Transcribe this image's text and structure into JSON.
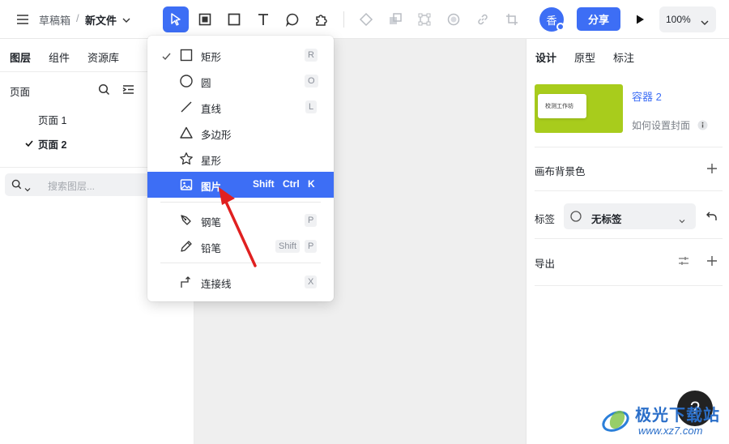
{
  "header": {
    "breadcrumb_root": "草稿箱",
    "breadcrumb_sep": "/",
    "file_name": "新文件",
    "avatar_text": "香",
    "share_label": "分享",
    "zoom_label": "100%"
  },
  "left_panel": {
    "tabs": [
      "图层",
      "组件",
      "资源库"
    ],
    "pages_title": "页面",
    "pages": [
      {
        "label": "页面 1",
        "selected": false
      },
      {
        "label": "页面 2",
        "selected": true
      }
    ],
    "search_placeholder": "搜索图层..."
  },
  "shape_menu": {
    "items": [
      {
        "label": "矩形",
        "shortcut": "R",
        "checked": true,
        "icon": "rectangle-icon"
      },
      {
        "label": "圆",
        "shortcut": "O",
        "checked": false,
        "icon": "circle-icon"
      },
      {
        "label": "直线",
        "shortcut": "L",
        "checked": false,
        "icon": "line-icon"
      },
      {
        "label": "多边形",
        "shortcut": "",
        "checked": false,
        "icon": "triangle-icon"
      },
      {
        "label": "星形",
        "shortcut": "",
        "checked": false,
        "icon": "star-icon"
      },
      {
        "label": "图片",
        "shortcut_keys": [
          "Shift",
          "Ctrl",
          "K"
        ],
        "highlighted": true,
        "icon": "image-icon"
      },
      {
        "label": "钢笔",
        "shortcut": "P",
        "checked": false,
        "icon": "pen-icon"
      },
      {
        "label": "铅笔",
        "shortcut_keys": [
          "Shift",
          "P"
        ],
        "checked": false,
        "icon": "pencil-icon"
      },
      {
        "label": "连接线",
        "shortcut": "X",
        "checked": false,
        "icon": "connector-icon"
      }
    ]
  },
  "right_panel": {
    "tabs": [
      "设计",
      "原型",
      "标注"
    ],
    "active_tab": "设计",
    "container_name": "容器 2",
    "thumb_text": "校测工作坊",
    "cover_help": "如何设置封面",
    "canvas_bg_label": "画布背景色",
    "tag_label": "标签",
    "tag_value": "无标签",
    "export_label": "导出"
  },
  "colors": {
    "accent": "#3d6ef5",
    "thumb_green": "#a8cc1c",
    "arrow_red": "#e02020",
    "canvas_bg": "#efefef"
  },
  "watermark": {
    "text_cn": "极光下载站",
    "text_en": "www.xz7.com"
  },
  "help_label": "?"
}
